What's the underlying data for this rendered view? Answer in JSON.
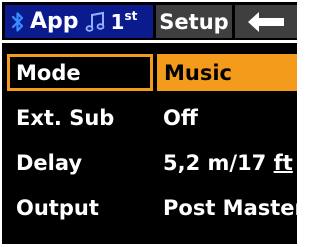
{
  "tabs": {
    "app": {
      "label": "App",
      "profile_number": "1",
      "profile_suffix": "st"
    },
    "setup": {
      "label": "Setup"
    },
    "back": {
      "icon": "arrow-left-icon"
    }
  },
  "icons": {
    "bluetooth": "bluetooth-icon",
    "music_note": "music-note-icon"
  },
  "colors": {
    "app_tab_bg": "#0b1b8e",
    "inactive_tab_bg": "#3f3f3f",
    "highlight": "#f59b1c",
    "background": "#000000",
    "text": "#ffffff"
  },
  "menu": {
    "rows": [
      {
        "label": "Mode",
        "value": "Music"
      },
      {
        "label": "Ext. Sub",
        "value": "Off"
      },
      {
        "label": "Delay",
        "value_main": "5,2 m/17 ",
        "value_unit": "ft"
      },
      {
        "label": "Output",
        "value": "Post Master"
      }
    ],
    "selected": "Mode"
  }
}
